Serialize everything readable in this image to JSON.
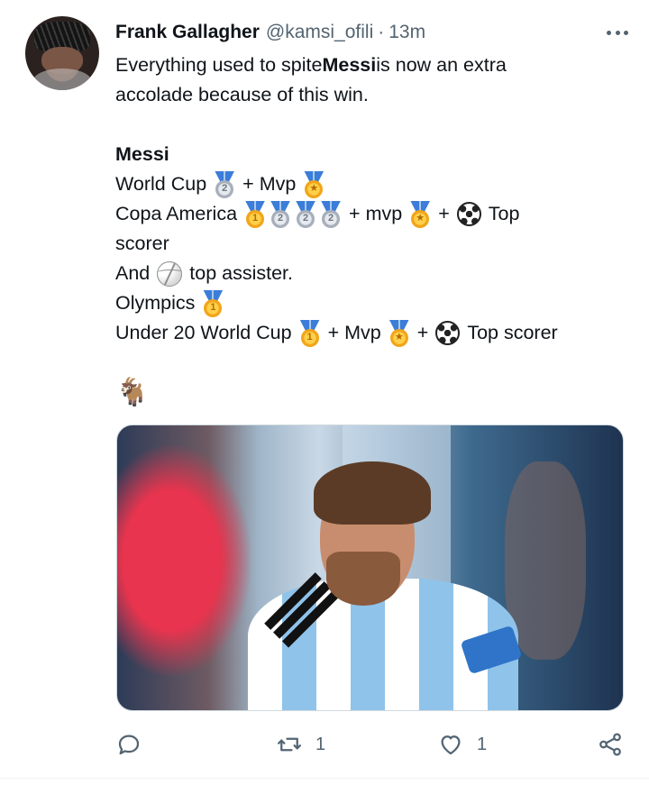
{
  "tweet": {
    "author_name": "Frank Gallagher",
    "author_handle": "@kamsi_ofili",
    "separator": "·",
    "time": "13m",
    "text": {
      "l1_before": "Everything used to spite ",
      "l1_bold": "Messi",
      "l1_after": " is now an extra",
      "l2": "accolade because of this win.",
      "heading": "Messi",
      "wc_label": "World Cup",
      "wc_plus": "+ Mvp",
      "copa_label": "Copa America",
      "copa_mvp": "+ mvp",
      "copa_plus": "+",
      "copa_top": "Top",
      "copa_scorer": "scorer",
      "and_label": "And",
      "and_after": "top assister.",
      "olympics_label": "Olympics",
      "u20_label": "Under 20 World Cup",
      "u20_mvp": "+ Mvp",
      "u20_plus": "+",
      "u20_top": "Top scorer"
    },
    "medal_silver_num": "2",
    "medal_gold_num": "1",
    "goat_emoji": "🐐",
    "icons": [
      "medal-gold",
      "medal-silver",
      "soccer-ball",
      "volleyball",
      "goat"
    ],
    "stats": {
      "replies": "",
      "retweets": "1",
      "likes": "1"
    }
  },
  "colors": {
    "text": "#0f1419",
    "secondary": "#536471",
    "border": "#cfd9de"
  }
}
